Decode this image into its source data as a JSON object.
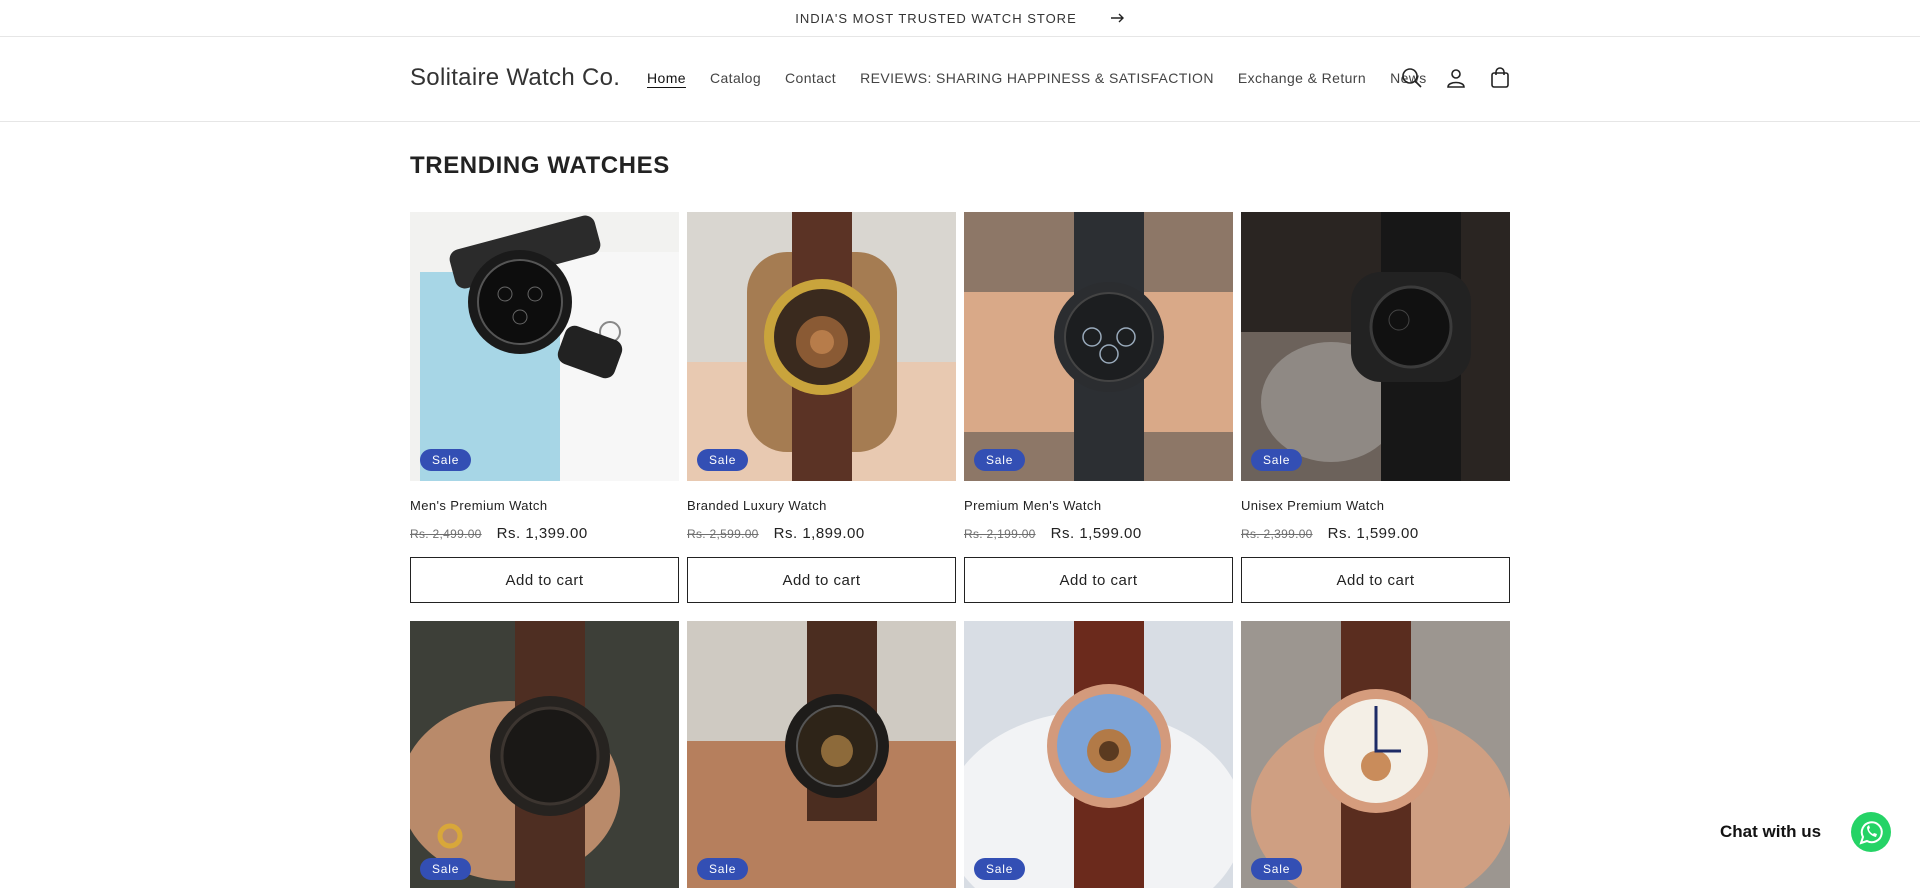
{
  "announcement": {
    "text": "INDIA'S MOST TRUSTED WATCH STORE",
    "icon": "arrow-right-icon"
  },
  "header": {
    "brand": "Solitaire Watch Co.",
    "nav": [
      {
        "label": "Home",
        "active": true
      },
      {
        "label": "Catalog"
      },
      {
        "label": "Contact"
      },
      {
        "label": "REVIEWS: SHARING HAPPINESS & SATISFACTION"
      },
      {
        "label": "Exchange & Return"
      },
      {
        "label": "News"
      }
    ],
    "icons": [
      "search-icon",
      "account-icon",
      "cart-icon"
    ]
  },
  "section": {
    "title": "TRENDING WATCHES"
  },
  "products": [
    {
      "title": "Men's Premium Watch",
      "badge": "Sale",
      "old_price": "Rs. 2,499.00",
      "price": "Rs. 1,399.00",
      "button": "Add to cart"
    },
    {
      "title": "Branded Luxury Watch",
      "badge": "Sale",
      "old_price": "Rs. 2,599.00",
      "price": "Rs. 1,899.00",
      "button": "Add to cart"
    },
    {
      "title": "Premium Men's Watch",
      "badge": "Sale",
      "old_price": "Rs. 2,199.00",
      "price": "Rs. 1,599.00",
      "button": "Add to cart"
    },
    {
      "title": "Unisex Premium Watch",
      "badge": "Sale",
      "old_price": "Rs. 2,399.00",
      "price": "Rs. 1,599.00",
      "button": "Add to cart"
    },
    {
      "badge": "Sale"
    },
    {
      "badge": "Sale"
    },
    {
      "badge": "Sale"
    },
    {
      "badge": "Sale"
    }
  ],
  "chat": {
    "label": "Chat with us",
    "icon": "whatsapp-icon"
  },
  "colors": {
    "sale_badge": "#334fb4",
    "whatsapp": "#25d366",
    "text": "#121212"
  }
}
